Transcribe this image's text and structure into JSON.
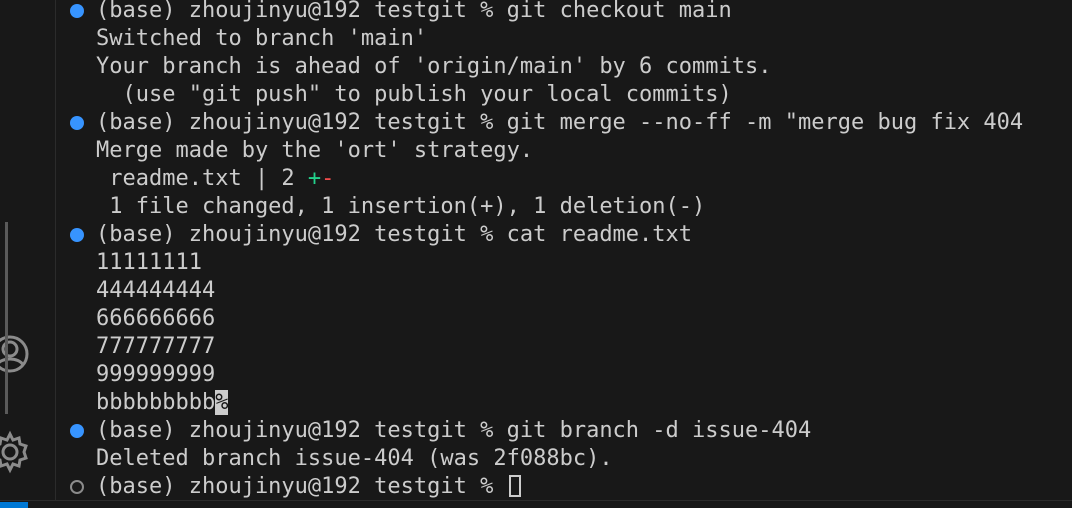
{
  "activity_bar": {
    "icons": [
      "account-icon",
      "settings-gear-icon"
    ]
  },
  "terminal": {
    "prompt": "(base) zhoujinyu@192 testgit % ",
    "lines": [
      {
        "kind": "cmd",
        "status": "ok",
        "text": "(base) zhoujinyu@192 testgit % git checkout main"
      },
      {
        "kind": "out",
        "text": "Switched to branch 'main'"
      },
      {
        "kind": "out",
        "text": "Your branch is ahead of 'origin/main' by 6 commits."
      },
      {
        "kind": "out",
        "text": "  (use \"git push\" to publish your local commits)"
      },
      {
        "kind": "cmd",
        "status": "ok",
        "text": "(base) zhoujinyu@192 testgit % git merge --no-ff -m \"merge bug fix 404"
      },
      {
        "kind": "out",
        "text": "Merge made by the 'ort' strategy."
      },
      {
        "kind": "diffstat",
        "file_text": " readme.txt | 2 ",
        "plus": "+",
        "minus": "-"
      },
      {
        "kind": "out",
        "text": " 1 file changed, 1 insertion(+), 1 deletion(-)"
      },
      {
        "kind": "cmd",
        "status": "ok",
        "text": "(base) zhoujinyu@192 testgit % cat readme.txt"
      },
      {
        "kind": "out",
        "text": "11111111"
      },
      {
        "kind": "out",
        "text": "444444444"
      },
      {
        "kind": "out",
        "text": "666666666"
      },
      {
        "kind": "out",
        "text": "777777777"
      },
      {
        "kind": "out",
        "text": "999999999"
      },
      {
        "kind": "eof",
        "text": "bbbbbbbbb",
        "mark": "%"
      },
      {
        "kind": "cmd",
        "status": "ok",
        "text": "(base) zhoujinyu@192 testgit % git branch -d issue-404"
      },
      {
        "kind": "out",
        "text": "Deleted branch issue-404 (was 2f088bc)."
      },
      {
        "kind": "prompt",
        "status": "pending",
        "text": "(base) zhoujinyu@192 testgit % "
      }
    ]
  },
  "colors": {
    "background": "#181818",
    "foreground": "#cccccc",
    "decoration_ok": "#3794ff",
    "decoration_pending": "#8b8b8b",
    "diff_plus": "#23d18b",
    "diff_minus": "#f14c4c",
    "accent": "#0078d4"
  }
}
